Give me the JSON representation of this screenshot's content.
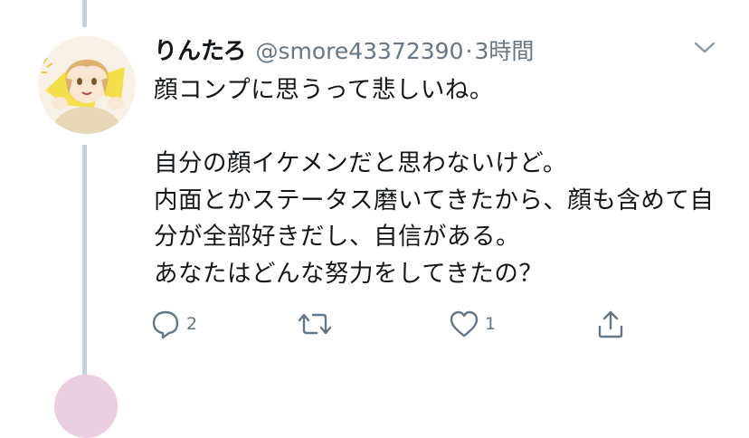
{
  "tweet": {
    "display_name": "りんたろ",
    "handle": "@smore43372390",
    "separator": "·",
    "time": "3時間",
    "body": "顔コンプに思うって悲しいね。\n\n自分の顔イケメンだと思わないけど。\n内面とかステータス磨いてきたから、顔も含めて自分が全部好きだし、自信がある。\nあなたはどんな努力をしてきたの？",
    "reply_count": "2",
    "like_count": "1"
  },
  "icons": {
    "menu": "chevron-down-icon",
    "reply": "comment-icon",
    "retweet": "retweet-icon",
    "like": "heart-icon",
    "share": "share-icon"
  },
  "colors": {
    "text": "#14171a",
    "secondary": "#657786",
    "thread_line": "#c4cfd6"
  }
}
